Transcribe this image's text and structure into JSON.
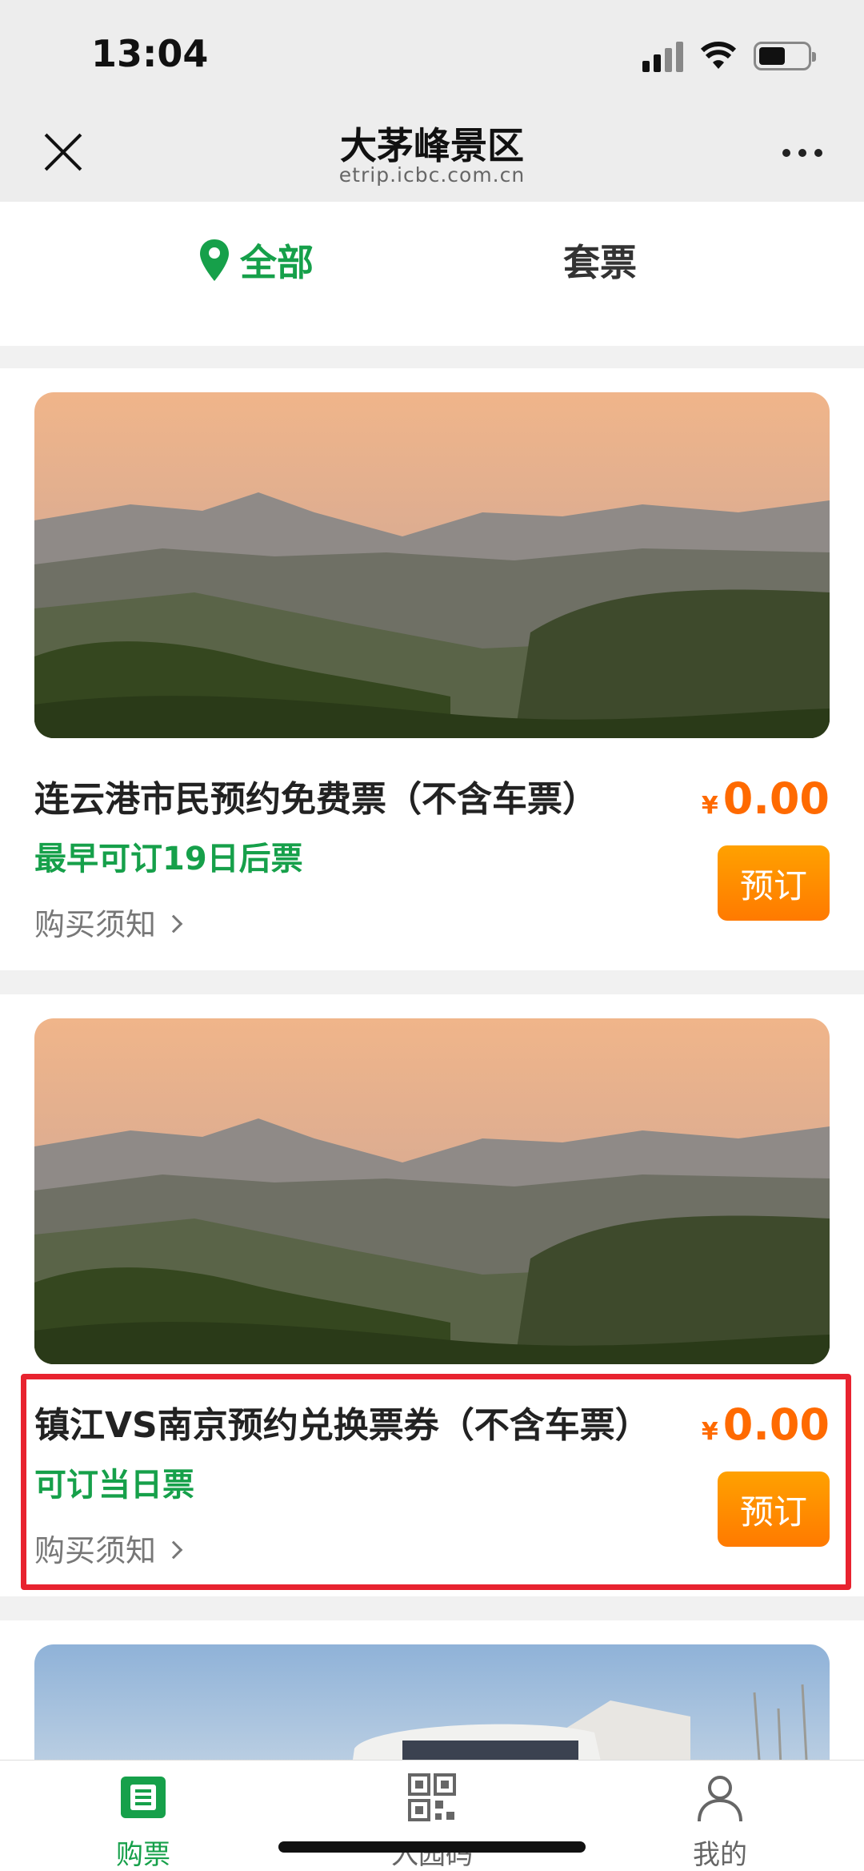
{
  "status_bar": {
    "time": "13:04"
  },
  "nav": {
    "title": "大茅峰景区",
    "subtitle": "etrip.icbc.com.cn"
  },
  "tabs": [
    {
      "label": "全部",
      "active": true
    },
    {
      "label": "套票",
      "active": false
    }
  ],
  "cards": [
    {
      "title": "连云港市民预约免费票（不含车票）",
      "note": "最早可订19日后票",
      "terms": "购买须知",
      "currency": "¥",
      "price": "0.00",
      "button": "预订"
    },
    {
      "title": "镇江VS南京预约兑换票券（不含车票）",
      "note": "可订当日票",
      "terms": "购买须知",
      "currency": "¥",
      "price": "0.00",
      "button": "预订"
    }
  ],
  "bottom_nav": [
    {
      "label": "购票",
      "icon": "ticket-icon",
      "active": true
    },
    {
      "label": "入园码",
      "icon": "qr-code-icon",
      "active": false
    },
    {
      "label": "我的",
      "icon": "user-icon",
      "active": false
    }
  ],
  "colors": {
    "accent_green": "#16a04a",
    "price_orange": "#ff6a00",
    "highlight_red": "#e8232f"
  }
}
